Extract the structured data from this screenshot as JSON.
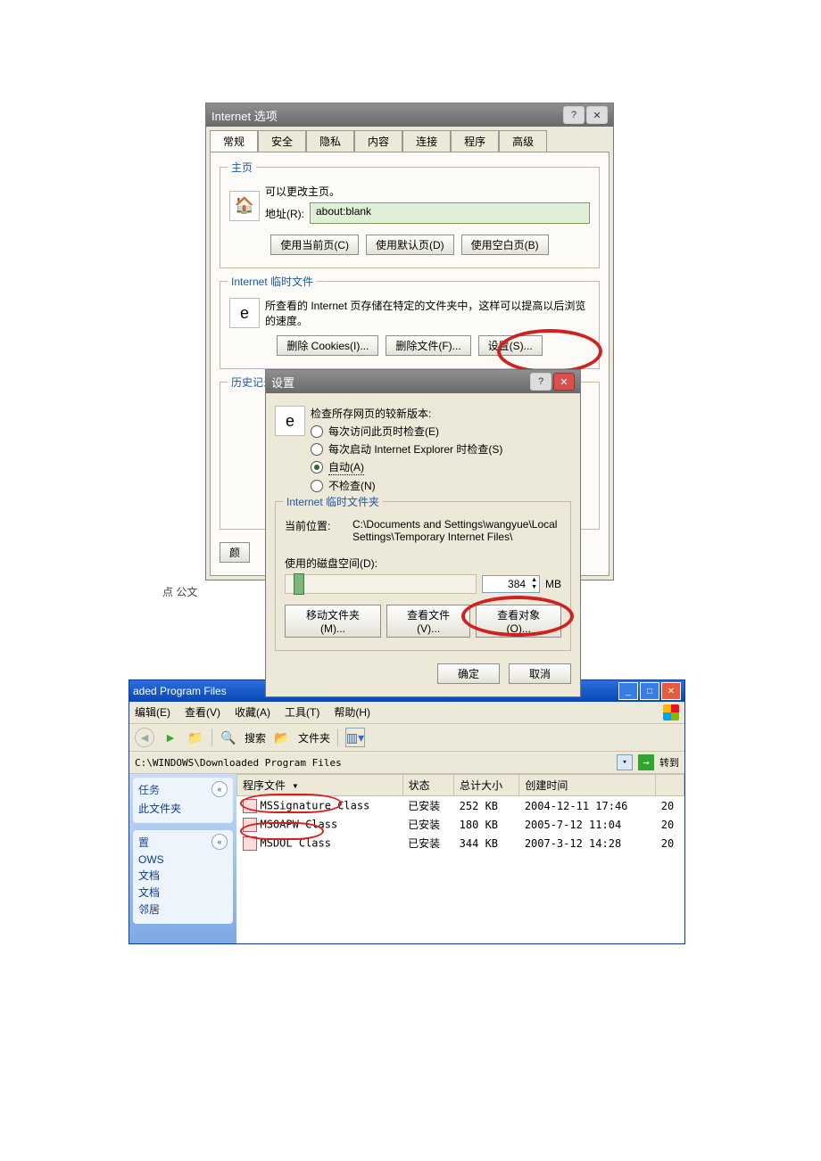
{
  "internet_options": {
    "title": "Internet 选项",
    "tabs": [
      "常规",
      "安全",
      "隐私",
      "内容",
      "连接",
      "程序",
      "高级"
    ],
    "home": {
      "legend": "主页",
      "desc": "可以更改主页。",
      "addr_label": "地址(R):",
      "addr_value": "about:blank",
      "use_current": "使用当前页(C)",
      "use_default": "使用默认页(D)",
      "use_blank": "使用空白页(B)"
    },
    "temp": {
      "legend": "Internet 临时文件",
      "desc": "所查看的 Internet 页存储在特定的文件夹中，这样可以提高以后浏览的速度。",
      "del_cookies": "删除 Cookies(I)...",
      "del_files": "删除文件(F)...",
      "settings": "设置(S)..."
    },
    "history": {
      "legend": "历史记录"
    },
    "color_btn": "颜"
  },
  "settings": {
    "title": "设置",
    "check_label": "检查所存网页的较新版本:",
    "radios": {
      "every_visit": "每次访问此页时检查(E)",
      "every_start": "每次启动 Internet Explorer 时检查(S)",
      "auto": "自动(A)",
      "never": "不检查(N)"
    },
    "folder": {
      "legend": "Internet 临时文件夹",
      "loc_label": "当前位置:",
      "loc_value": "C:\\Documents and Settings\\wangyue\\Local Settings\\Temporary Internet Files\\",
      "disk_label": "使用的磁盘空间(D):",
      "disk_value": "384",
      "disk_unit": "MB",
      "move": "移动文件夹(M)...",
      "view_files": "查看文件(V)...",
      "view_objects": "查看对象(O)..."
    },
    "ok": "确定",
    "cancel": "取消"
  },
  "desktop_hint": "点 公文",
  "explorer": {
    "title": "aded Program Files",
    "menus": {
      "edit": "编辑(E)",
      "view": "查看(V)",
      "fav": "收藏(A)",
      "tools": "工具(T)",
      "help": "帮助(H)"
    },
    "toolbar": {
      "search": "搜索",
      "folders": "文件夹"
    },
    "address": "C:\\WINDOWS\\Downloaded Program Files",
    "go": "转到",
    "side": {
      "tasks": "任务",
      "this_folder": "此文件夹",
      "places_hd": "置",
      "places": [
        "OWS",
        "文档",
        "文档",
        "邻居"
      ]
    },
    "cols": {
      "name": "程序文件",
      "status": "状态",
      "size": "总计大小",
      "ctime": "创建时间"
    },
    "rows": [
      {
        "name": "MSSignature Class",
        "status": "已安装",
        "size": "252 KB",
        "ctime": "2004-12-11 17:46",
        "trail": "20"
      },
      {
        "name": "MSOAPW Class",
        "status": "已安装",
        "size": "180 KB",
        "ctime": "2005-7-12 11:04",
        "trail": "20"
      },
      {
        "name": "MSDOL Class",
        "status": "已安装",
        "size": "344 KB",
        "ctime": "2007-3-12 14:28",
        "trail": "20"
      }
    ]
  }
}
